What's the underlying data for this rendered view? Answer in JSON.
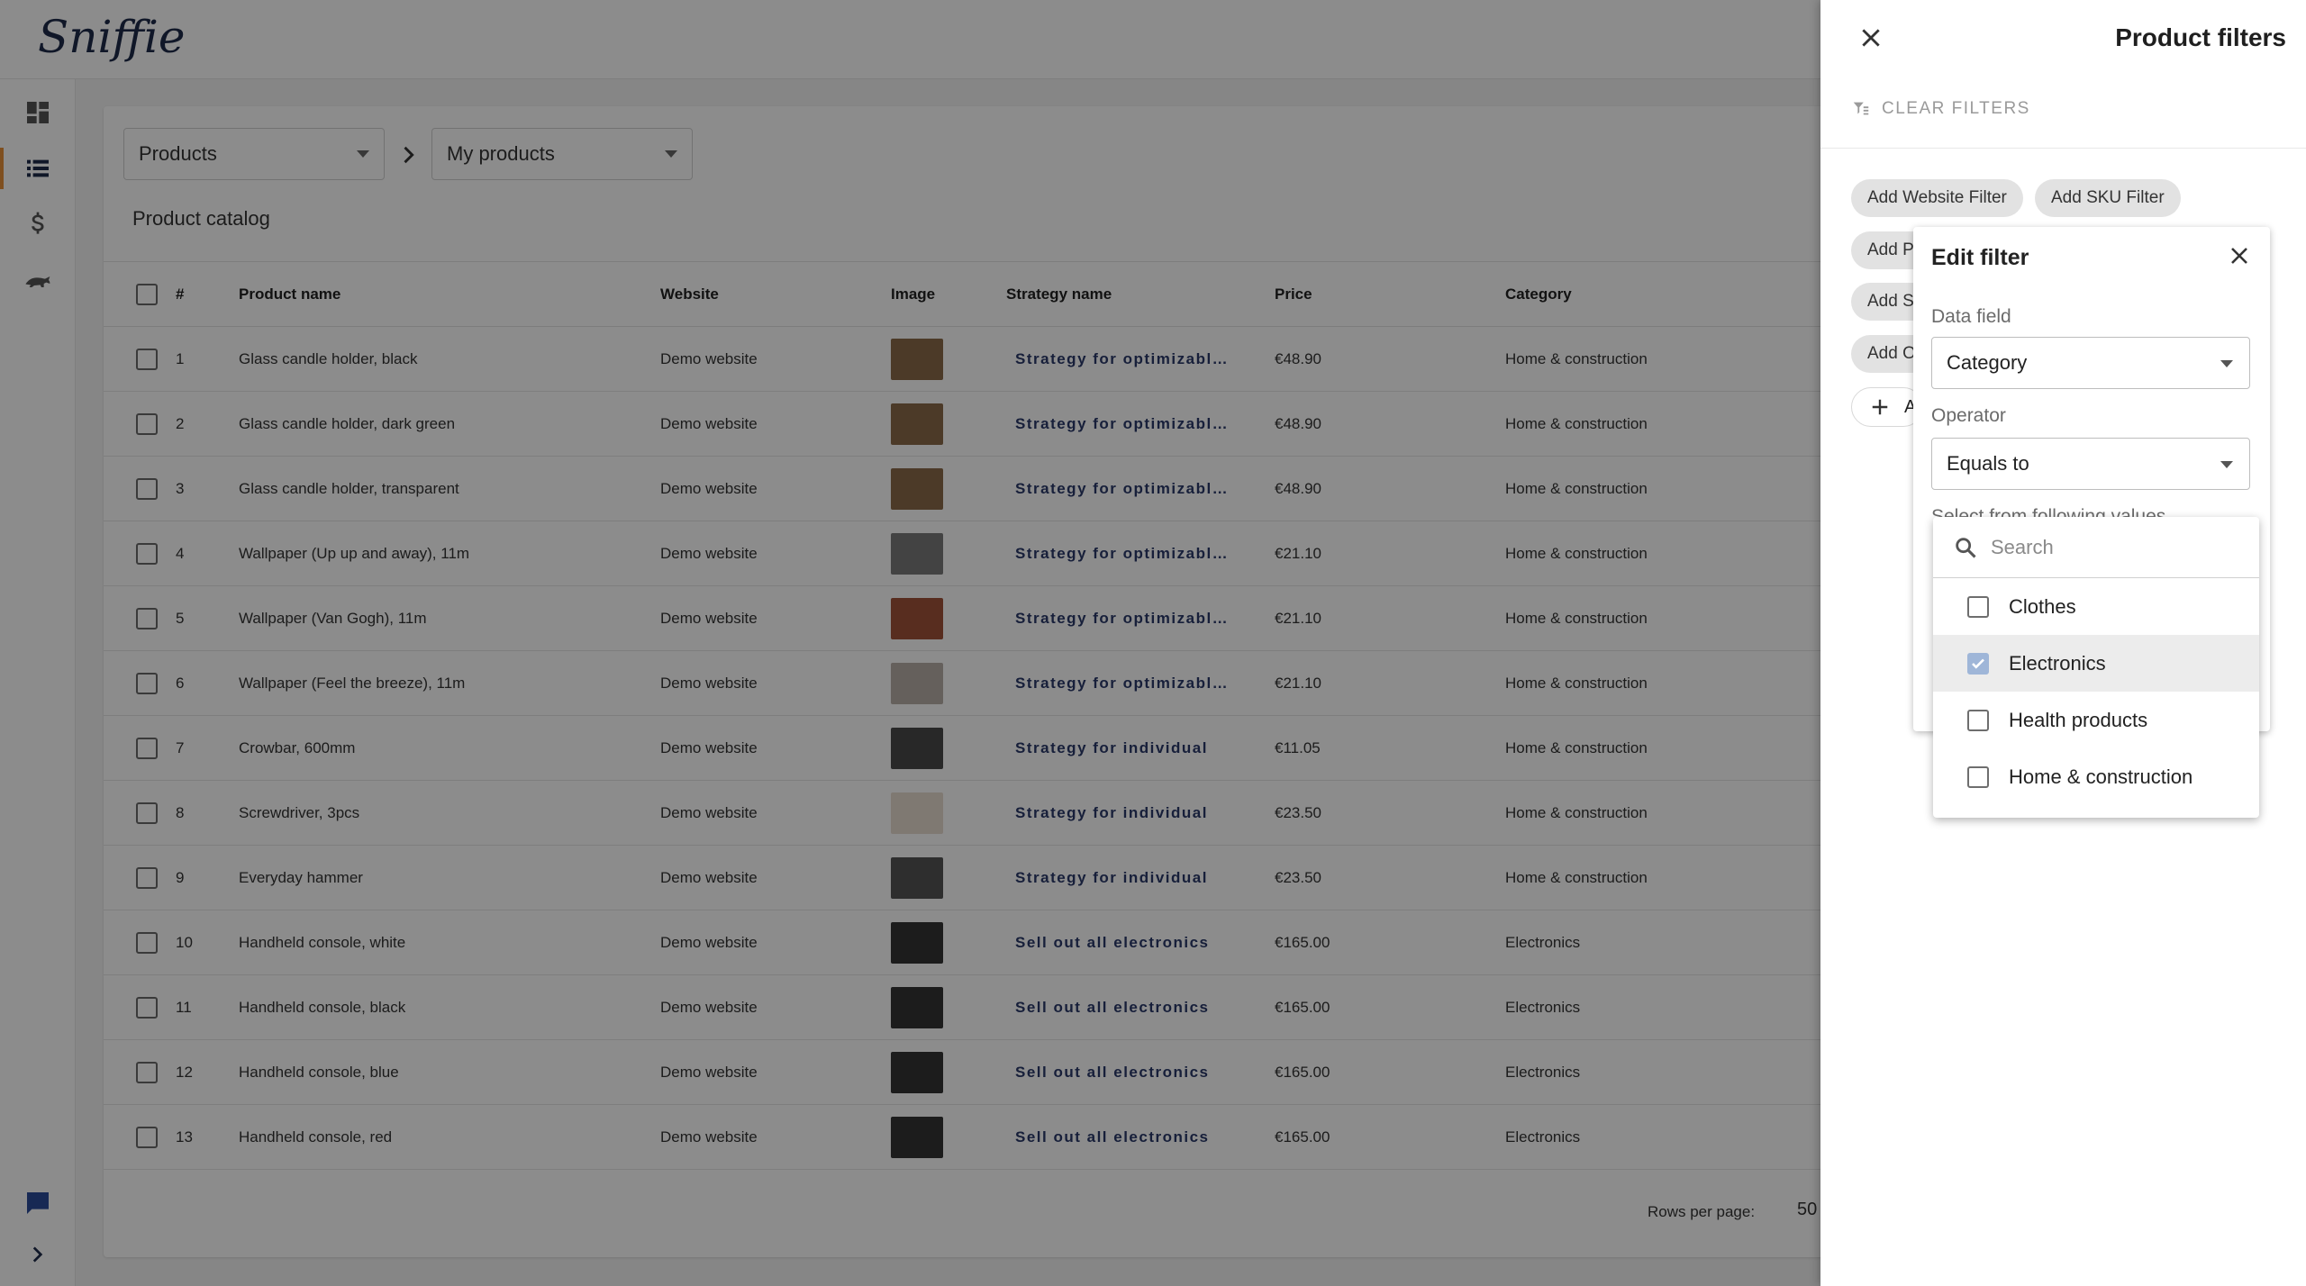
{
  "app": {
    "logo_text": "Sniffie"
  },
  "breadcrumb": {
    "primary": "Products",
    "secondary": "My products"
  },
  "catalog": {
    "title": "Product catalog",
    "columns": [
      "#",
      "Product name",
      "Website",
      "Image",
      "Strategy name",
      "Price",
      "Category"
    ],
    "rows": [
      {
        "n": "1",
        "name": "Glass candle holder, black",
        "website": "Demo website",
        "strategy": "Strategy for optimizabl…",
        "price": "€48.90",
        "category": "Home & construction"
      },
      {
        "n": "2",
        "name": "Glass candle holder, dark green",
        "website": "Demo website",
        "strategy": "Strategy for optimizabl…",
        "price": "€48.90",
        "category": "Home & construction"
      },
      {
        "n": "3",
        "name": "Glass candle holder, transparent",
        "website": "Demo website",
        "strategy": "Strategy for optimizabl…",
        "price": "€48.90",
        "category": "Home & construction"
      },
      {
        "n": "4",
        "name": "Wallpaper (Up up and away), 11m",
        "website": "Demo website",
        "strategy": "Strategy for optimizabl…",
        "price": "€21.10",
        "category": "Home & construction"
      },
      {
        "n": "5",
        "name": "Wallpaper (Van Gogh), 11m",
        "website": "Demo website",
        "strategy": "Strategy for optimizabl…",
        "price": "€21.10",
        "category": "Home & construction"
      },
      {
        "n": "6",
        "name": "Wallpaper (Feel the breeze), 11m",
        "website": "Demo website",
        "strategy": "Strategy for optimizabl…",
        "price": "€21.10",
        "category": "Home & construction"
      },
      {
        "n": "7",
        "name": "Crowbar, 600mm",
        "website": "Demo website",
        "strategy": "Strategy for individual",
        "price": "€11.05",
        "category": "Home & construction"
      },
      {
        "n": "8",
        "name": "Screwdriver, 3pcs",
        "website": "Demo website",
        "strategy": "Strategy for individual",
        "price": "€23.50",
        "category": "Home & construction"
      },
      {
        "n": "9",
        "name": "Everyday hammer",
        "website": "Demo website",
        "strategy": "Strategy for individual",
        "price": "€23.50",
        "category": "Home & construction"
      },
      {
        "n": "10",
        "name": "Handheld console, white",
        "website": "Demo website",
        "strategy": "Sell out all electronics",
        "price": "€165.00",
        "category": "Electronics"
      },
      {
        "n": "11",
        "name": "Handheld console, black",
        "website": "Demo website",
        "strategy": "Sell out all electronics",
        "price": "€165.00",
        "category": "Electronics"
      },
      {
        "n": "12",
        "name": "Handheld console, blue",
        "website": "Demo website",
        "strategy": "Sell out all electronics",
        "price": "€165.00",
        "category": "Electronics"
      },
      {
        "n": "13",
        "name": "Handheld console, red",
        "website": "Demo website",
        "strategy": "Sell out all electronics",
        "price": "€165.00",
        "category": "Electronics"
      }
    ],
    "rows_per_page_label": "Rows per page:",
    "rows_per_page_value": "50"
  },
  "drawer": {
    "title": "Product filters",
    "clear_label": "CLEAR FILTERS",
    "chips": {
      "website": "Add Website Filter",
      "sku": "Add SKU Filter",
      "row2": "Add P",
      "row3": "Add S",
      "row4": "Add O",
      "add_partial": "A"
    }
  },
  "edit_filter": {
    "title": "Edit filter",
    "data_field_label": "Data field",
    "data_field_value": "Category",
    "operator_label": "Operator",
    "operator_value": "Equals to",
    "values_label": "Select from following values"
  },
  "dropdown": {
    "search_placeholder": "Search",
    "options": [
      {
        "label": "Clothes",
        "checked": false
      },
      {
        "label": "Electronics",
        "checked": true
      },
      {
        "label": "Health products",
        "checked": false
      },
      {
        "label": "Home & construction",
        "checked": false
      }
    ]
  },
  "colors": {
    "accent": "#e8913a",
    "strategy_text": "#2a3a6a",
    "checked_box": "#9fb6d8"
  }
}
